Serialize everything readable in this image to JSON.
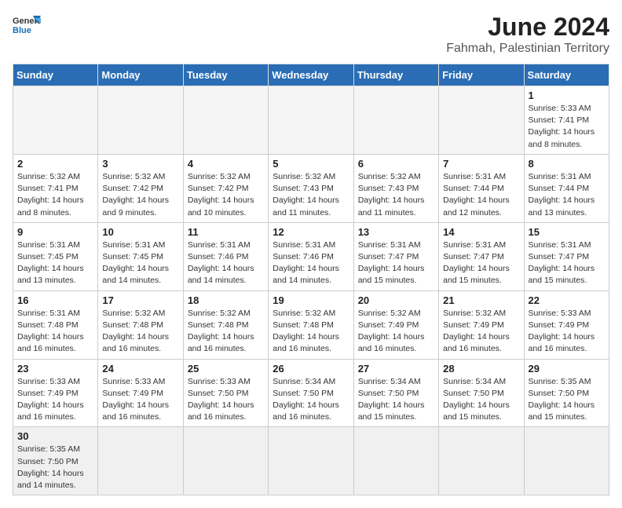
{
  "header": {
    "logo_general": "General",
    "logo_blue": "Blue",
    "month": "June 2024",
    "location": "Fahmah, Palestinian Territory"
  },
  "weekdays": [
    "Sunday",
    "Monday",
    "Tuesday",
    "Wednesday",
    "Thursday",
    "Friday",
    "Saturday"
  ],
  "weeks": [
    [
      {
        "day": "",
        "info": ""
      },
      {
        "day": "",
        "info": ""
      },
      {
        "day": "",
        "info": ""
      },
      {
        "day": "",
        "info": ""
      },
      {
        "day": "",
        "info": ""
      },
      {
        "day": "",
        "info": ""
      },
      {
        "day": "1",
        "info": "Sunrise: 5:33 AM\nSunset: 7:41 PM\nDaylight: 14 hours\nand 8 minutes."
      }
    ],
    [
      {
        "day": "2",
        "info": "Sunrise: 5:32 AM\nSunset: 7:41 PM\nDaylight: 14 hours\nand 8 minutes."
      },
      {
        "day": "3",
        "info": "Sunrise: 5:32 AM\nSunset: 7:42 PM\nDaylight: 14 hours\nand 9 minutes."
      },
      {
        "day": "4",
        "info": "Sunrise: 5:32 AM\nSunset: 7:42 PM\nDaylight: 14 hours\nand 10 minutes."
      },
      {
        "day": "5",
        "info": "Sunrise: 5:32 AM\nSunset: 7:43 PM\nDaylight: 14 hours\nand 11 minutes."
      },
      {
        "day": "6",
        "info": "Sunrise: 5:32 AM\nSunset: 7:43 PM\nDaylight: 14 hours\nand 11 minutes."
      },
      {
        "day": "7",
        "info": "Sunrise: 5:31 AM\nSunset: 7:44 PM\nDaylight: 14 hours\nand 12 minutes."
      },
      {
        "day": "8",
        "info": "Sunrise: 5:31 AM\nSunset: 7:44 PM\nDaylight: 14 hours\nand 13 minutes."
      }
    ],
    [
      {
        "day": "9",
        "info": "Sunrise: 5:31 AM\nSunset: 7:45 PM\nDaylight: 14 hours\nand 13 minutes."
      },
      {
        "day": "10",
        "info": "Sunrise: 5:31 AM\nSunset: 7:45 PM\nDaylight: 14 hours\nand 14 minutes."
      },
      {
        "day": "11",
        "info": "Sunrise: 5:31 AM\nSunset: 7:46 PM\nDaylight: 14 hours\nand 14 minutes."
      },
      {
        "day": "12",
        "info": "Sunrise: 5:31 AM\nSunset: 7:46 PM\nDaylight: 14 hours\nand 14 minutes."
      },
      {
        "day": "13",
        "info": "Sunrise: 5:31 AM\nSunset: 7:47 PM\nDaylight: 14 hours\nand 15 minutes."
      },
      {
        "day": "14",
        "info": "Sunrise: 5:31 AM\nSunset: 7:47 PM\nDaylight: 14 hours\nand 15 minutes."
      },
      {
        "day": "15",
        "info": "Sunrise: 5:31 AM\nSunset: 7:47 PM\nDaylight: 14 hours\nand 15 minutes."
      }
    ],
    [
      {
        "day": "16",
        "info": "Sunrise: 5:31 AM\nSunset: 7:48 PM\nDaylight: 14 hours\nand 16 minutes."
      },
      {
        "day": "17",
        "info": "Sunrise: 5:32 AM\nSunset: 7:48 PM\nDaylight: 14 hours\nand 16 minutes."
      },
      {
        "day": "18",
        "info": "Sunrise: 5:32 AM\nSunset: 7:48 PM\nDaylight: 14 hours\nand 16 minutes."
      },
      {
        "day": "19",
        "info": "Sunrise: 5:32 AM\nSunset: 7:48 PM\nDaylight: 14 hours\nand 16 minutes."
      },
      {
        "day": "20",
        "info": "Sunrise: 5:32 AM\nSunset: 7:49 PM\nDaylight: 14 hours\nand 16 minutes."
      },
      {
        "day": "21",
        "info": "Sunrise: 5:32 AM\nSunset: 7:49 PM\nDaylight: 14 hours\nand 16 minutes."
      },
      {
        "day": "22",
        "info": "Sunrise: 5:33 AM\nSunset: 7:49 PM\nDaylight: 14 hours\nand 16 minutes."
      }
    ],
    [
      {
        "day": "23",
        "info": "Sunrise: 5:33 AM\nSunset: 7:49 PM\nDaylight: 14 hours\nand 16 minutes."
      },
      {
        "day": "24",
        "info": "Sunrise: 5:33 AM\nSunset: 7:49 PM\nDaylight: 14 hours\nand 16 minutes."
      },
      {
        "day": "25",
        "info": "Sunrise: 5:33 AM\nSunset: 7:50 PM\nDaylight: 14 hours\nand 16 minutes."
      },
      {
        "day": "26",
        "info": "Sunrise: 5:34 AM\nSunset: 7:50 PM\nDaylight: 14 hours\nand 16 minutes."
      },
      {
        "day": "27",
        "info": "Sunrise: 5:34 AM\nSunset: 7:50 PM\nDaylight: 14 hours\nand 15 minutes."
      },
      {
        "day": "28",
        "info": "Sunrise: 5:34 AM\nSunset: 7:50 PM\nDaylight: 14 hours\nand 15 minutes."
      },
      {
        "day": "29",
        "info": "Sunrise: 5:35 AM\nSunset: 7:50 PM\nDaylight: 14 hours\nand 15 minutes."
      }
    ],
    [
      {
        "day": "30",
        "info": "Sunrise: 5:35 AM\nSunset: 7:50 PM\nDaylight: 14 hours\nand 14 minutes."
      },
      {
        "day": "",
        "info": ""
      },
      {
        "day": "",
        "info": ""
      },
      {
        "day": "",
        "info": ""
      },
      {
        "day": "",
        "info": ""
      },
      {
        "day": "",
        "info": ""
      },
      {
        "day": "",
        "info": ""
      }
    ]
  ]
}
